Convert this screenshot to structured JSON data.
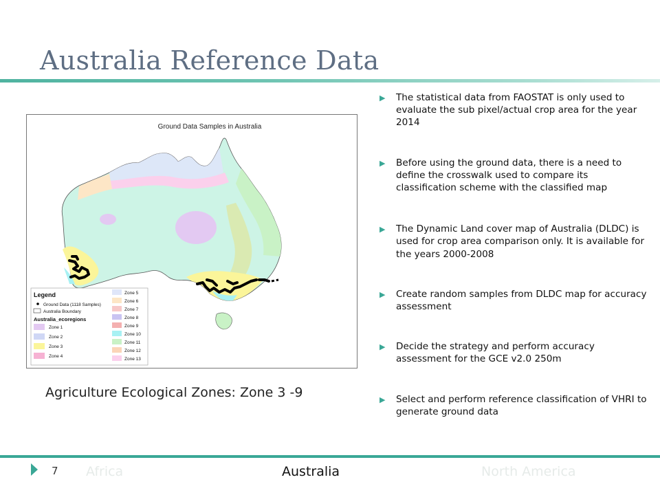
{
  "slide": {
    "title": "Australia Reference Data",
    "page_number": "7",
    "caption": "Agriculture Ecological Zones: Zone 3 -9"
  },
  "map": {
    "title": "Ground Data Samples in Australia",
    "legend": {
      "heading": "Legend",
      "samples_label": "Ground Data (1118 Samples)",
      "boundary_label": "Australia Boundary",
      "ecoregions_heading": "Australia_ecoregions",
      "zones": [
        {
          "label": "Zone 1",
          "color": "#e3c9f2"
        },
        {
          "label": "Zone 2",
          "color": "#cfd7f5"
        },
        {
          "label": "Zone 3",
          "color": "#fbf59a"
        },
        {
          "label": "Zone 4",
          "color": "#f6b2d3"
        },
        {
          "label": "Zone 5",
          "color": "#dfe6f9"
        },
        {
          "label": "Zone 6",
          "color": "#fde6c6"
        },
        {
          "label": "Zone 7",
          "color": "#f7c8c8"
        },
        {
          "label": "Zone 8",
          "color": "#c9c4f2"
        },
        {
          "label": "Zone 9",
          "color": "#f4b0b0"
        },
        {
          "label": "Zone 10",
          "color": "#a8f1f3"
        },
        {
          "label": "Zone 11",
          "color": "#c9f2c6"
        },
        {
          "label": "Zone 12",
          "color": "#fbd5b8"
        },
        {
          "label": "Zone 13",
          "color": "#fbd0ec"
        }
      ]
    }
  },
  "bullets": [
    "The statistical data from FAOSTAT is only used to evaluate the sub pixel/actual crop area for the year 2014",
    "Before using the ground data, there is a need to define the crosswalk used to compare its classification scheme with the classified map",
    "The Dynamic Land cover map of Australia (DLDC) is used for crop area comparison only. It is available for the years 2000-2008",
    "Create random samples from DLDC map for accuracy assessment",
    "Decide the strategy and perform accuracy assessment for the GCE v2.0 250m",
    "Select and perform reference classification of VHRI to generate ground data"
  ],
  "footer": {
    "nav_prev": "Africa",
    "nav_current": "Australia",
    "nav_next": "North America"
  }
}
